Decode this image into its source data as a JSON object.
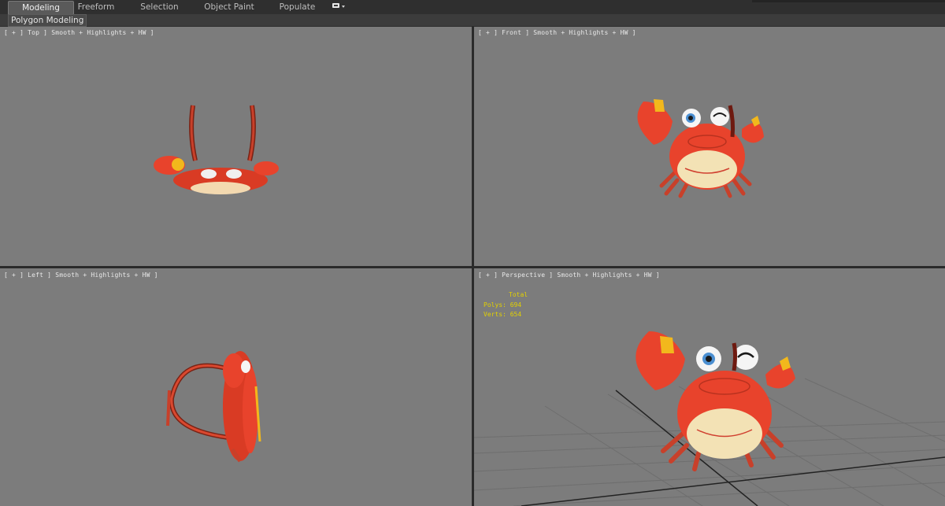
{
  "tabs": [
    "Modeling",
    "Freeform",
    "Selection",
    "Object Paint",
    "Populate"
  ],
  "active_tab": "Modeling",
  "sub_tab": "Polygon Modeling",
  "viewports": {
    "top": "[ + ] Top ] Smooth + Highlights + HW ]",
    "front": "[ + ] Front ] Smooth + Highlights + HW ]",
    "left": "[ + ] Left ] Smooth + Highlights + HW ]",
    "perspective": "[ + ] Perspective ] Smooth + Highlights + HW ]"
  },
  "stats": {
    "header": "Total",
    "polys": "Polys: 694",
    "verts": "Verts: 654"
  },
  "colors": {
    "viewport_bg": "#7c7c7c",
    "crab_body": "#e8432c",
    "belly": "#f3e2b5",
    "stats_text": "#e3d100"
  }
}
